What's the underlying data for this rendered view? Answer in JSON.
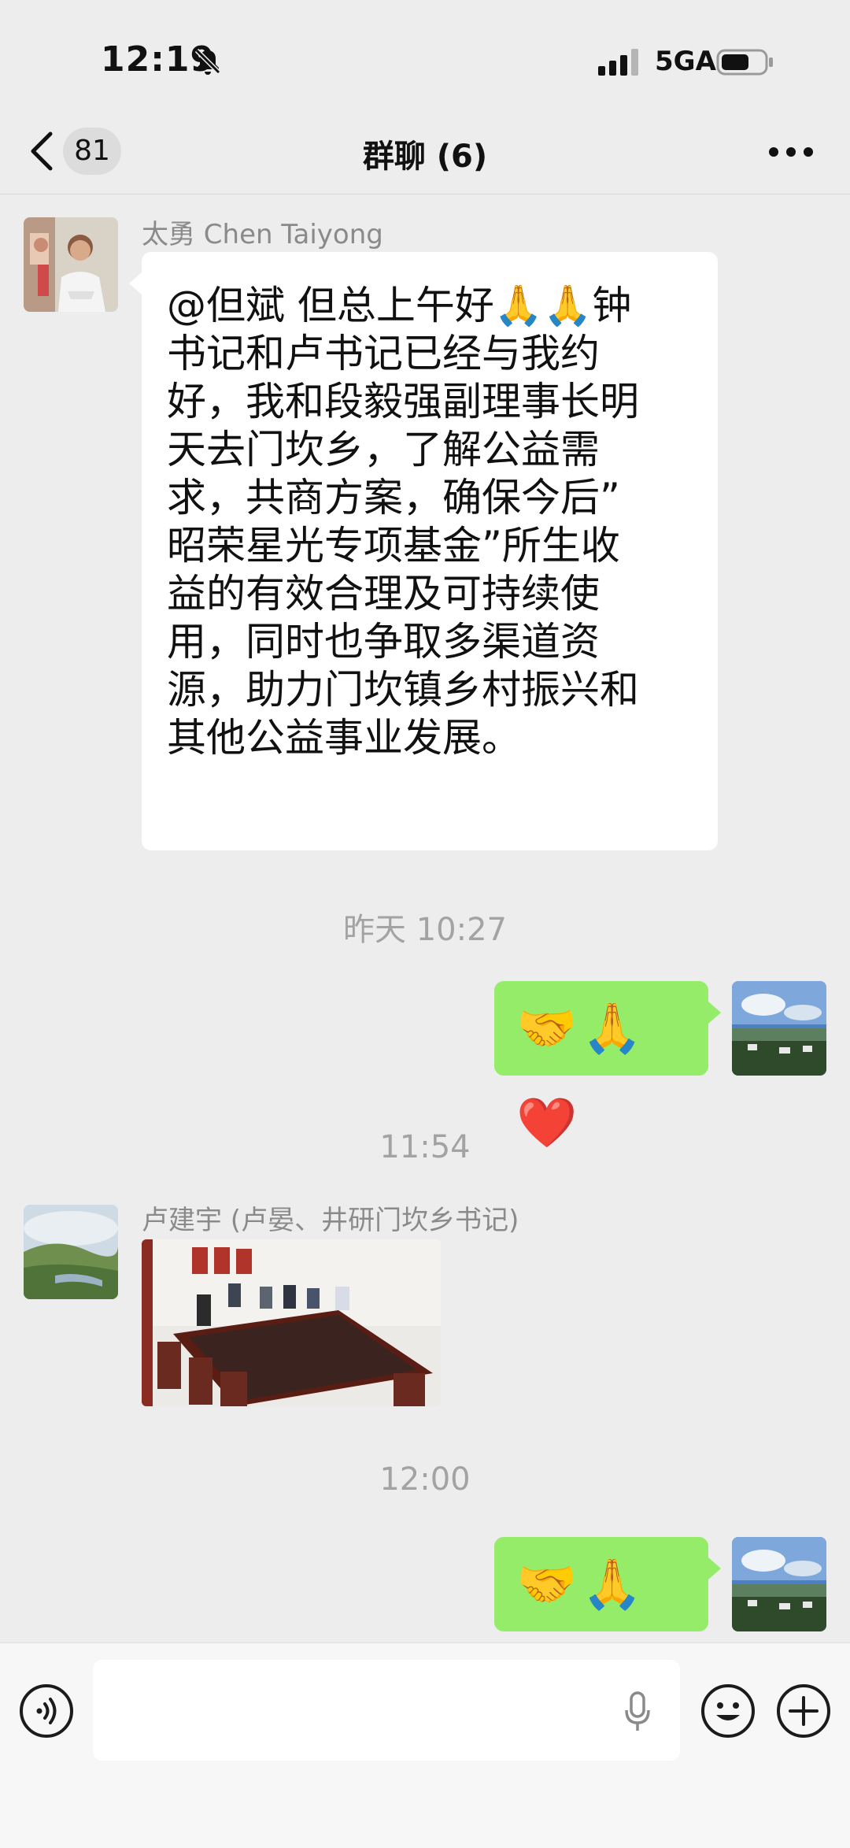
{
  "status_bar": {
    "time": "12:19",
    "network": "5GA"
  },
  "nav": {
    "back_count": "81",
    "title": "群聊 (6)"
  },
  "messages": [
    {
      "sender": "太勇 Chen Taiyong",
      "lines": [
        "@但斌 但总上午好🙏🙏钟",
        "书记和卢书记已经与我约",
        "好，我和段毅强副理事长明",
        "天去门坎乡，了解公益需",
        "求，共商方案，确保今后”",
        "昭荣星光专项基金”所生收",
        "益的有效合理及可持续使",
        "用，同时也争取多渠道资",
        "源，助力门坎镇乡村振兴和",
        "其他公益事业发展。"
      ]
    },
    {
      "timestamp": "昨天 10:27"
    },
    {
      "self_emojis": "🤝🙏❤️"
    },
    {
      "timestamp": "11:54"
    },
    {
      "sender": "卢建宇 (卢晏、井研门坎乡书记)"
    },
    {
      "timestamp": "12:00"
    },
    {
      "self_emojis": "🤝🙏👍"
    }
  ],
  "colors": {
    "self_bubble": "#95ec69",
    "other_bubble": "#ffffff",
    "background": "#ededed"
  },
  "icons": [
    "bell-muted-icon",
    "signal-icon",
    "battery-icon",
    "back-chevron-icon",
    "more-icon",
    "voice-icon",
    "mic-icon",
    "emoji-icon",
    "plus-icon"
  ]
}
